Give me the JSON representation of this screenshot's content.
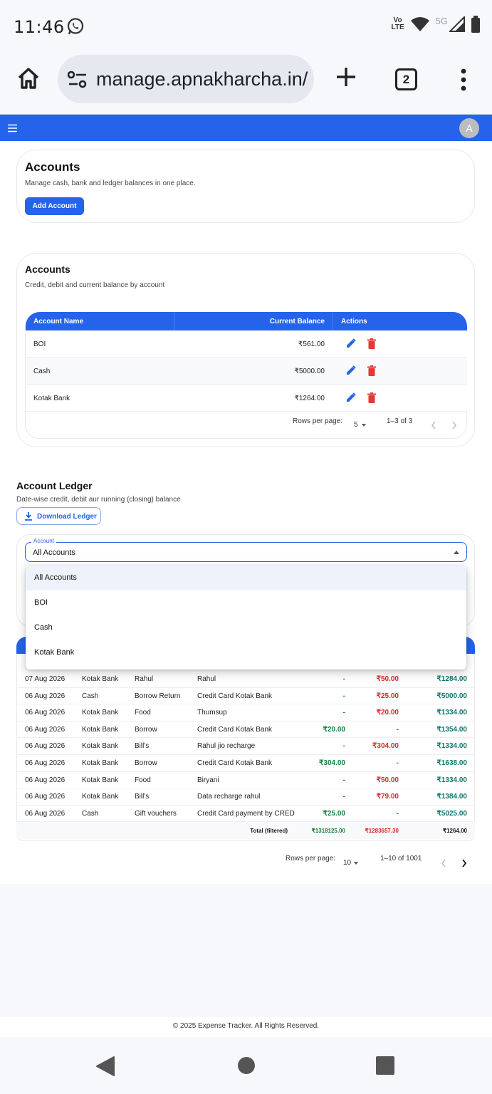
{
  "status": {
    "time": "11:46",
    "volte_top": "Vo",
    "volte_bottom": "LTE",
    "net": "5G"
  },
  "browser": {
    "url": "manage.apnakharcha.in/",
    "tab_count": "2"
  },
  "appbar": {
    "avatar_initial": "A",
    "color": "#2563eb"
  },
  "header_card": {
    "title": "Accounts",
    "subtitle": "Manage cash, bank and ledger balances in one place.",
    "add_button": "Add Account"
  },
  "accounts_card": {
    "title": "Accounts",
    "subtitle": "Credit, debit and current balance by account",
    "columns": [
      "Account Name",
      "Current Balance",
      "Actions"
    ],
    "rows": [
      {
        "name": "BOI",
        "balance": "₹561.00"
      },
      {
        "name": "Cash",
        "balance": "₹5000.00"
      },
      {
        "name": "Kotak Bank",
        "balance": "₹1264.00"
      }
    ],
    "rows_per_page_label": "Rows per page:",
    "rows_per_page": "5",
    "range": "1–3 of 3"
  },
  "ledger": {
    "title": "Account Ledger",
    "subtitle": "Date-wise credit, debit aur running (closing) balance",
    "download_button": "Download Ledger",
    "account_label": "Account",
    "account_value": "All Accounts",
    "options": [
      "All Accounts",
      "BOI",
      "Cash",
      "Kotak Bank"
    ],
    "rows": [
      {
        "date": "07 Aug 2026",
        "account": "Kotak Bank",
        "category": "Rahul",
        "note": "Rahul",
        "credit": "-",
        "debit": "₹50.00",
        "balance": "₹1284.00"
      },
      {
        "date": "06 Aug 2026",
        "account": "Cash",
        "category": "Borrow Return",
        "note": "Credit Card Kotak Bank",
        "credit": "-",
        "debit": "₹25.00",
        "balance": "₹5000.00"
      },
      {
        "date": "06 Aug 2026",
        "account": "Kotak Bank",
        "category": "Food",
        "note": "Thumsup",
        "credit": "-",
        "debit": "₹20.00",
        "balance": "₹1334.00"
      },
      {
        "date": "06 Aug 2026",
        "account": "Kotak Bank",
        "category": "Borrow",
        "note": "Credit Card Kotak Bank",
        "credit": "₹20.00",
        "debit": "-",
        "balance": "₹1354.00"
      },
      {
        "date": "06 Aug 2026",
        "account": "Kotak Bank",
        "category": "Bill's",
        "note": "Rahul jio recharge",
        "credit": "-",
        "debit": "₹304.00",
        "balance": "₹1334.00"
      },
      {
        "date": "06 Aug 2026",
        "account": "Kotak Bank",
        "category": "Borrow",
        "note": "Credit Card Kotak Bank",
        "credit": "₹304.00",
        "debit": "-",
        "balance": "₹1638.00"
      },
      {
        "date": "06 Aug 2026",
        "account": "Kotak Bank",
        "category": "Food",
        "note": "Biryani",
        "credit": "-",
        "debit": "₹50.00",
        "balance": "₹1334.00"
      },
      {
        "date": "06 Aug 2026",
        "account": "Kotak Bank",
        "category": "Bill's",
        "note": "Data recharge rahul",
        "credit": "-",
        "debit": "₹79.00",
        "balance": "₹1384.00"
      },
      {
        "date": "06 Aug 2026",
        "account": "Cash",
        "category": "Gift vouchers",
        "note": "Credit Card payment by CRED",
        "credit": "₹25.00",
        "debit": "-",
        "balance": "₹5025.00"
      }
    ],
    "total_label": "Total (filtered)",
    "total_credit": "₹1318125.00",
    "total_debit": "₹1283657.30",
    "total_balance": "₹1264.00",
    "rows_per_page_label": "Rows per page:",
    "rows_per_page": "10",
    "range": "1–10 of 1001"
  },
  "footer": "© 2025 Expense Tracker. All Rights Reserved."
}
